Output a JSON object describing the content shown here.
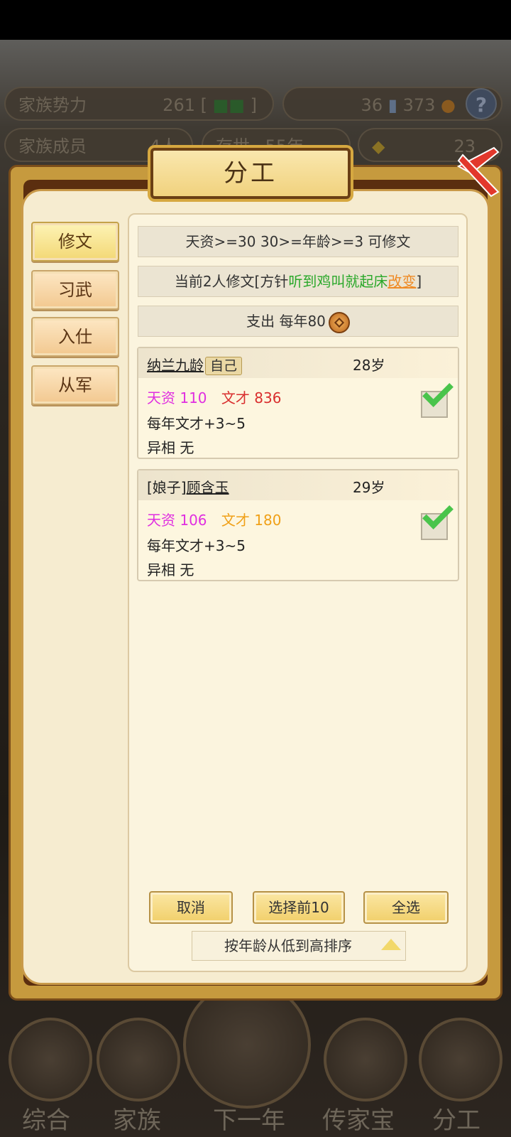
{
  "background": {
    "power_label": "家族势力",
    "power_value": "261 [",
    "power_rank": "]",
    "resource_value": "36",
    "coin_value": "373",
    "help_icon": "question-icon",
    "members_label": "家族成员",
    "members_value": "4人",
    "alive_label": "存世",
    "alive_value": "55年",
    "gold_value": "23"
  },
  "dialog": {
    "title": "分工",
    "close_icon": "close-x-icon"
  },
  "tabs": [
    {
      "label": "修文",
      "active": true
    },
    {
      "label": "习武",
      "active": false
    },
    {
      "label": "入仕",
      "active": false
    },
    {
      "label": "从军",
      "active": false
    }
  ],
  "info": {
    "requirement": "天资>=30 30>=年龄>=3 可修文",
    "current_prefix": "当前2人修文[方针",
    "policy": "听到鸡叫就起床",
    "change": "改变",
    "current_suffix": "]",
    "cost": "支出 每年80"
  },
  "members": [
    {
      "name": "纳兰九龄",
      "badge": "自己",
      "age": "28岁",
      "talent_label": "天资",
      "talent_value": "110",
      "lit_label": "文才",
      "lit_value": "836",
      "yearly": "每年文才+3~5",
      "trait": "异相 无",
      "checked": true
    },
    {
      "prefix": "[娘子]",
      "name": "顾含玉",
      "age": "29岁",
      "talent_label": "天资",
      "talent_value": "106",
      "lit_label": "文才",
      "lit_value": "180",
      "yearly": "每年文才+3~5",
      "trait": "异相 无",
      "checked": true
    }
  ],
  "buttons": {
    "cancel": "取消",
    "select_top10": "选择前10",
    "select_all": "全选"
  },
  "sort": {
    "label": "按年龄从低到高排序"
  },
  "bottom_nav": [
    "综合",
    "家族",
    "下一年",
    "传家宝",
    "分工"
  ],
  "colors": {
    "accent_gold": "#f1cf6a",
    "talent": "#e02fe0",
    "lit_high": "#d92e2e",
    "lit_low": "#f0a017",
    "policy": "#2aa82a",
    "change": "#ef8b26"
  }
}
